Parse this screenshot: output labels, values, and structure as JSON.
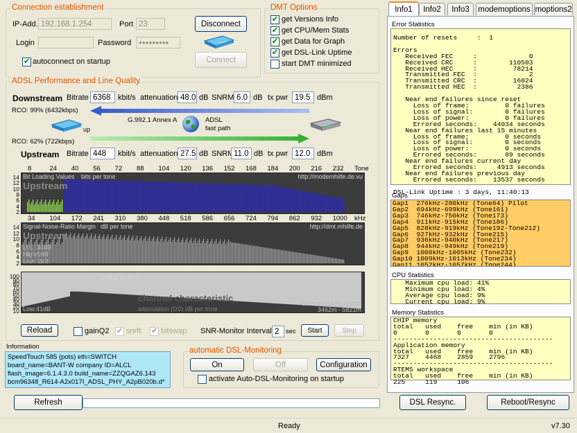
{
  "connection": {
    "title": "Connection establishment",
    "ip_label": "IP-Add.",
    "ip_value": "192.168.1.254",
    "port_label": "Port",
    "port_value": "23",
    "login_label": "Login",
    "login_value": "",
    "password_label": "Password",
    "password_value": "●●●●●●●●●",
    "autoconnect_label": "autoconnect on startup",
    "autoconnect_checked": true,
    "disconnect_label": "Disconnect",
    "connect_label": "Connect"
  },
  "dmt": {
    "title": "DMT Options",
    "options": [
      {
        "label": "get Versions Info",
        "checked": true
      },
      {
        "label": "get CPU/Mem Stats",
        "checked": true
      },
      {
        "label": "get Data for Graph",
        "checked": true
      },
      {
        "label": "get DSL-Link Uptime",
        "checked": true
      },
      {
        "label": "start DMT minimized",
        "checked": false
      }
    ]
  },
  "adsl": {
    "title": "ADSL Performance and Line Quality",
    "bitrate_label": "Bitrate",
    "bitrate_unit": "kbit/s",
    "atten_label": "attenuation",
    "atten_unit": "dB",
    "snrm_label": "SNRM",
    "snrm_unit": "dB",
    "txpwr_label": "tx pwr",
    "txpwr_unit": "dBm",
    "downstream": {
      "label": "Downstream",
      "bitrate": "6368",
      "attenuation": "48.0",
      "snrm": "6.0",
      "txpwr": "19.5"
    },
    "upstream": {
      "label": "Upstream",
      "bitrate": "448",
      "attenuation": "27.5",
      "snrm": "11.0",
      "txpwr": "12.0"
    },
    "rco_down": "RCO: 99% (6432kbps)",
    "rco_up": "RCO: 62% (722kbps)",
    "mode": "G.992.1 Annex A",
    "adsl_label": "ADSL",
    "fastpath": "fast path",
    "up_label": "up"
  },
  "charts": {
    "tone_axis": [
      "8",
      "24",
      "40",
      "56",
      "72",
      "88",
      "104",
      "120",
      "136",
      "152",
      "168",
      "184",
      "200",
      "216",
      "232",
      "Tone"
    ],
    "khz_axis": [
      "34",
      "104",
      "172",
      "241",
      "310",
      "380",
      "448",
      "518",
      "586",
      "656",
      "724",
      "794",
      "862",
      "932",
      "1000",
      "kHz"
    ],
    "bitload": {
      "title": "Bit Loading Values",
      "subtitle": "bits per tone",
      "watermark": "Upstream",
      "url": "http://modemhilfe.de.vu",
      "yticks": [
        "14",
        "12",
        "10",
        "8",
        "6",
        "4",
        "2"
      ]
    },
    "snr": {
      "title": "Signal-Noise-Ratio Margin",
      "subtitle": "dB per tone",
      "watermark": "Upstream",
      "url": "http://dmt.mhilfe.de",
      "yticks": [
        "14",
        "12",
        "10",
        "8",
        "6",
        "4",
        "2"
      ],
      "l01": "L01 :34dB",
      "high": "High:9dB",
      "low": "Low :2dB"
    },
    "channel": {
      "title": "channel characteristic",
      "subtitle": "attenuation (DS) dB per tone",
      "peak": "45dB@300kHz",
      "loop_label": "estimated loop length",
      "loop_value": "3462m - 5821m",
      "low": "Low:41dB",
      "yticks": [
        "100",
        "90",
        "80",
        "70",
        "60",
        "50",
        "40",
        "30",
        "20",
        "10"
      ]
    }
  },
  "controls": {
    "reload_label": "Reload",
    "gainq2_label": "gainQ2",
    "gainq2_checked": false,
    "snrft_label": "snrft",
    "snrft_checked": true,
    "bitswap_label": "bitswap",
    "bitswap_checked": true,
    "snr_interval_label": "SNR-Monitor Interval:",
    "snr_interval_value": "2",
    "sec_label": "sec",
    "start_label": "Start",
    "stop_label": "Stop"
  },
  "information": {
    "title": "Information",
    "lines": [
      "SpeedTouch 585 (pots) eth=SWITCH",
      "board_name=BANT-W   company ID=ALCL",
      "flash_image=6.1.4.3.0  build_name=ZZQGAZ6.143",
      "bcm96348_R614-A2x017I_ADSL_PHY_A2pB020b.d*"
    ]
  },
  "auto_monitor": {
    "title": "automatic DSL-Monitoring",
    "on_label": "On",
    "off_label": "Off",
    "config_label": "Configuration",
    "activate_label": "activate Auto-DSL-Monitoring on startup",
    "activate_checked": false
  },
  "tabs": [
    {
      "label": "Info1",
      "active": true
    },
    {
      "label": "Info2"
    },
    {
      "label": "Info3"
    },
    {
      "label": "modemoptions"
    },
    {
      "label": "moptions2"
    }
  ],
  "error_stats": {
    "title": "Error Statistics",
    "text": "Number of resets     :  1\n\nErrors\n   Received FEC     :             0\n   Received CRC     :        110503\n   Received HEC     :         78214\n   Transmitted FEC  :             2\n   Transmitted CRC  :         16824\n   Transmitted HEC  :          2386\n\n   Near end failures since reset\n     Loss of frame:         0 failures\n     Loss of signal:        0 failures\n     Loss of power:         0 failures\n     Errored seconds:    44034 seconds\n   Near end failures last 15 minutes\n     Loss of frame:         0 seconds\n     Loss of signal:        0 seconds\n     Loss of power:         0 seconds\n     Errored seconds:       89 seconds\n   Near end failures current day\n     Errored seconds:     4913 seconds\n   Near end failures previous day\n     Errored seconds:    13537 seconds\n\nDSL-Link Uptime : 3 days, 11:40:13"
  },
  "gaps": {
    "title": "Gaps",
    "items": [
      "Gap1  276kHz-280kHz (Tone64) Pilot",
      "Gap2  694kHz-699kHz (Tone161)",
      "Gap3  746kHz-750kHz (Tone173)",
      "Gap4  911kHz-915kHz (Tone186)",
      "Gap5  828kHz-919kHz (Tone192-Tone212)",
      "Gap6  927kHz-932kHz (Tone215)",
      "Gap7  936kHz-940kHz (Tone217)",
      "Gap8  944kHz-949kHz (Tone219)",
      "Gap9  1000kHz-1005kHz (Tone232)",
      "Gap10 1009kHz-1013kHz (Tone234)",
      "Gap11 1052kHz-1057kHz (Tone244)",
      "Gap12 1061kHz-1065kHz (Tone246)"
    ]
  },
  "cpu_stats": {
    "title": "CPU Statistics",
    "text": "   Maximum cpu load: 41%\n   Minimum cpu load: 4%\n   Average cpu load: 9%\n   Current cpu load: 9%"
  },
  "memory_stats": {
    "title": "Memory Statistics",
    "text": "CHIP memory\ntotal   used    free    min (in KB)\n0       0       0       0\n----------------------------------------\nApplication memory\ntotal   used    free    min (in KB)\n7327    4468    2859    2796\n----------------------------------------\nRTEMS workspace\ntotal   used    free    min (in KB)\n225     119     106"
  },
  "bottom": {
    "refresh_label": "Refresh",
    "resync_label": "DSL Resync.",
    "reboot_label": "Reboot/Resync",
    "status": "Ready",
    "version": "v7.30"
  },
  "colors": {
    "accent": "#e25400",
    "bitload_bars": "#2a2ab8",
    "bitload_up": "#8fd24a",
    "snr_bars": "#9a9a9a",
    "arrow_down": "#4b6fd6",
    "arrow_up": "#3db83d",
    "info_bg": "#aee7f8",
    "panel_bg": "#ffffc0",
    "gaps_bg": "#ffcc66"
  },
  "icons": [
    "modem-icon",
    "globe-icon",
    "router-icon",
    "arrow-left-icon",
    "arrow-right-icon"
  ]
}
